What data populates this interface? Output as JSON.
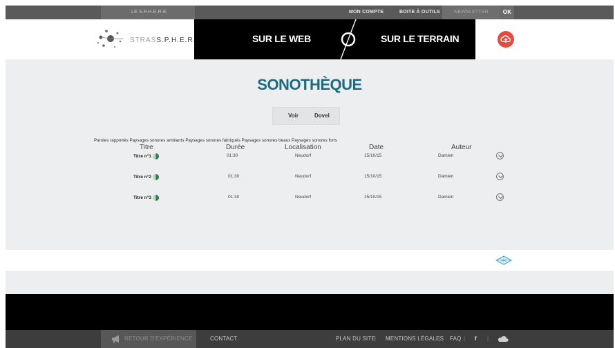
{
  "topbar": {
    "logo_text": "LE S.P.H.E.R.E",
    "account": "MON COMPTE",
    "tools": "BOITE À OUTILS",
    "newsletter": "NEWSLETTER",
    "ok": "OK"
  },
  "header": {
    "logo_prefix": "STRAS",
    "logo_suffix": "S.P.H.E.R.E",
    "nav_web": "SUR LE WEB",
    "nav_terrain": "SUR LE TERRAIN"
  },
  "main": {
    "title": "SONOTHÈQUE",
    "filter_buttons": [
      "Voir",
      "Dovel"
    ],
    "categories": [
      "Paroles rapportés",
      "Paysages sonores ambiants",
      "Paysages sonores fabriqués",
      "Paysages sonores beaux",
      "Paysages sonores forts"
    ],
    "columns": [
      "Titre",
      "Durée",
      "Localisation",
      "Date",
      "Auteur"
    ],
    "rows": [
      {
        "title": "Titre n°1",
        "duration": "01:30",
        "location": "Neudorf",
        "date": "15/10/15",
        "author": "Damien"
      },
      {
        "title": "Titre n°2",
        "duration": "01:30",
        "location": "Neudorf",
        "date": "15/10/15",
        "author": "Damien"
      },
      {
        "title": "Titre n°3",
        "duration": "01:30",
        "location": "Neudorf",
        "date": "15/10/15",
        "author": "Damien"
      }
    ]
  },
  "footer": {
    "back": "RETOUR D'EXPÉRIENCE",
    "contact": "CONTACT",
    "sitemap": "PLAN DU SITE",
    "legal": "MENTIONS LÉGALES",
    "faq": "FAQ",
    "facebook": "f"
  },
  "colors": {
    "accent_title": "#1e6a7f",
    "cloud_button": "#e34b3d",
    "topbar": "#5a5a5a",
    "footer": "#3d3d3d"
  }
}
